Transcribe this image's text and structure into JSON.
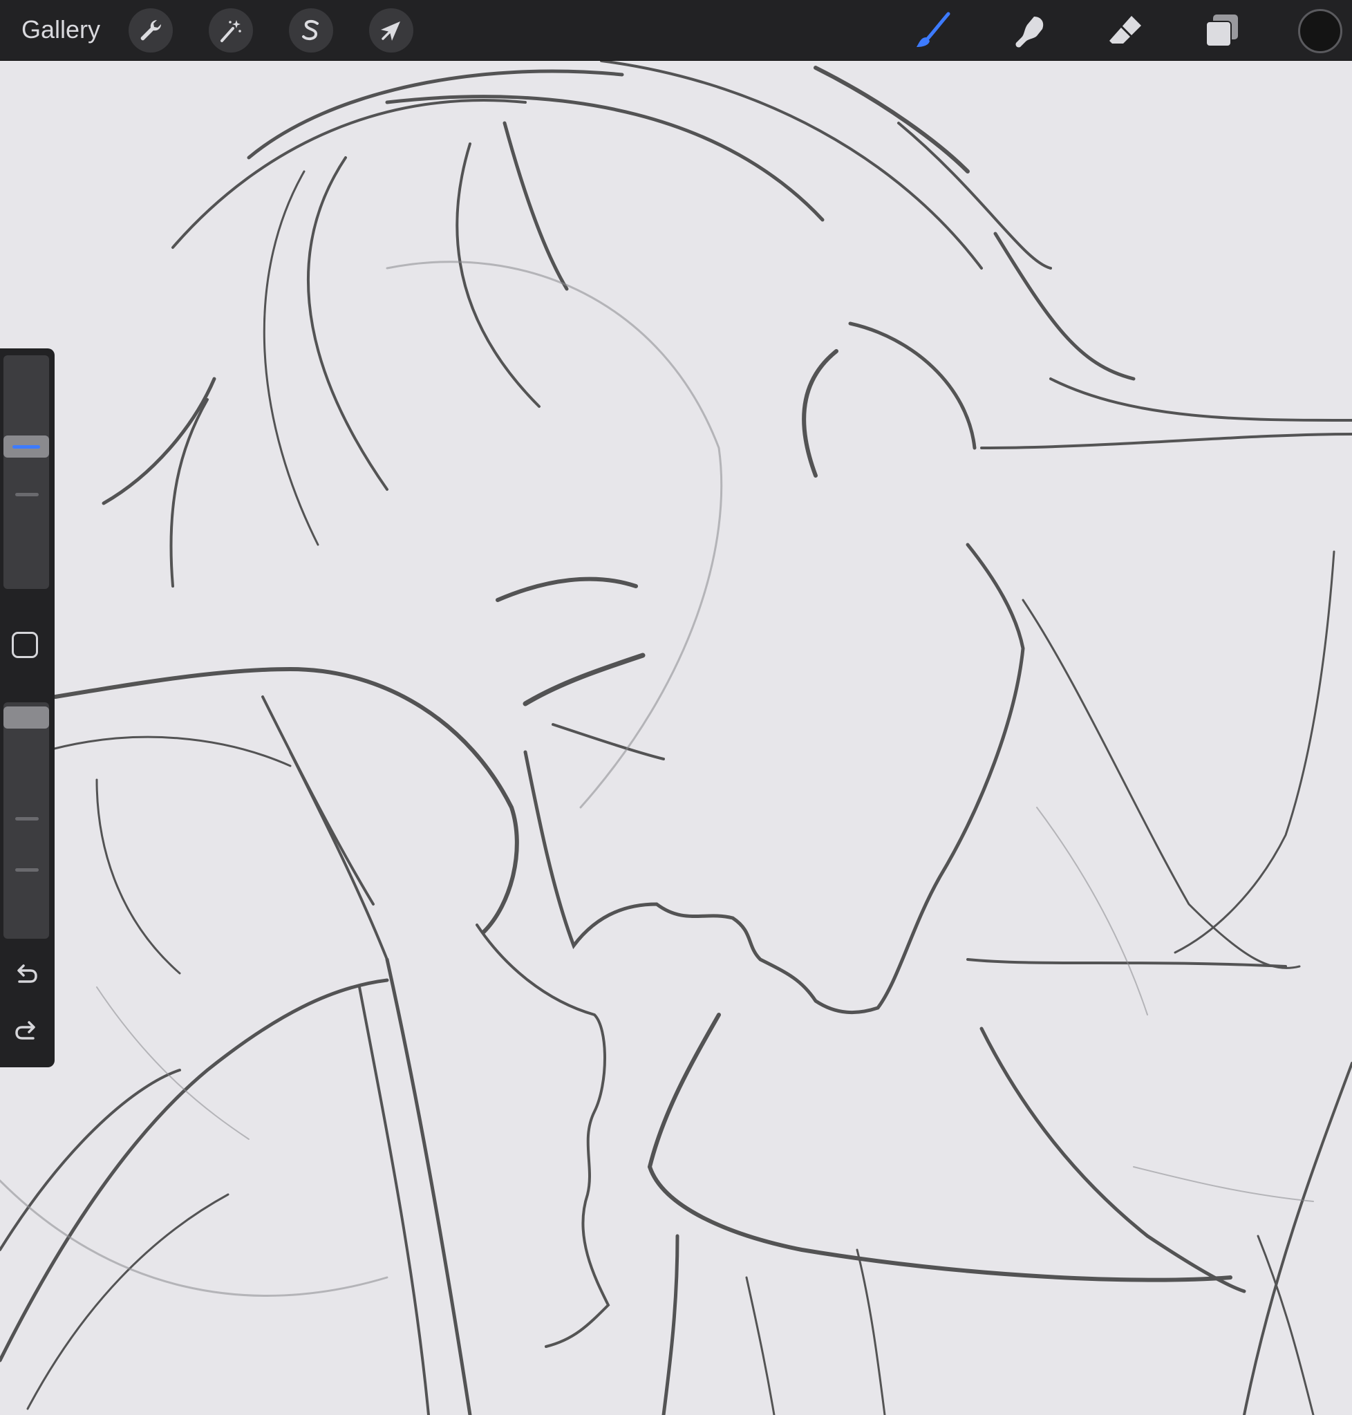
{
  "topbar": {
    "gallery_label": "Gallery",
    "left_tools": [
      {
        "name": "actions",
        "icon": "wrench-icon"
      },
      {
        "name": "adjustments",
        "icon": "magic-wand-icon"
      },
      {
        "name": "selection",
        "icon": "selection-s-icon"
      },
      {
        "name": "transform",
        "icon": "arrow-cursor-icon"
      }
    ],
    "right_tools": [
      {
        "name": "brush",
        "icon": "brush-icon",
        "active": true
      },
      {
        "name": "smudge",
        "icon": "smudge-finger-icon"
      },
      {
        "name": "eraser",
        "icon": "eraser-icon"
      },
      {
        "name": "layers",
        "icon": "layers-icon"
      }
    ],
    "current_color": "#141414"
  },
  "sidebar": {
    "brush_size_level": 0.62,
    "brush_opacity_level": 0.98,
    "icons": [
      "modify-square-icon",
      "undo-icon",
      "redo-icon"
    ]
  },
  "colors": {
    "accent": "#3d7bff",
    "toolbar_bg": "#222224",
    "canvas_bg": "#e7e6ea",
    "sketch_stroke": "#3a3a3a"
  }
}
